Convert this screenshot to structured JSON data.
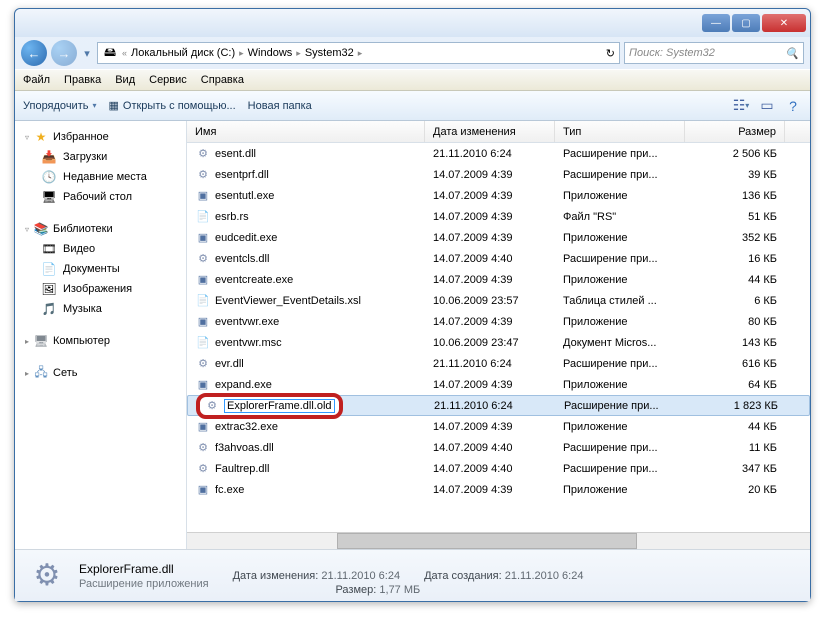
{
  "titlebar": {
    "min": "—",
    "max": "▢",
    "close": "✕"
  },
  "nav": {
    "back": "←",
    "fwd": "→",
    "drop": "▾"
  },
  "address": {
    "icon": "🖴",
    "crumbs": [
      "Локальный диск (C:)",
      "Windows",
      "System32"
    ],
    "sep": "▸",
    "refresh": "↻"
  },
  "search": {
    "placeholder": "Поиск: System32",
    "icon": "🔍"
  },
  "menu": [
    "Файл",
    "Правка",
    "Вид",
    "Сервис",
    "Справка"
  ],
  "toolbar": {
    "organize": "Упорядочить",
    "openwith": "Открыть с помощью...",
    "newfolder": "Новая папка",
    "drop": "▾"
  },
  "sidebar": {
    "favorites": {
      "label": "Избранное",
      "arr": "▿",
      "items": [
        {
          "icon": "📥",
          "label": "Загрузки"
        },
        {
          "icon": "🕓",
          "label": "Недавние места"
        },
        {
          "icon": "🖥",
          "label": "Рабочий стол"
        }
      ]
    },
    "libraries": {
      "label": "Библиотеки",
      "arr": "▿",
      "items": [
        {
          "icon": "🎞",
          "label": "Видео"
        },
        {
          "icon": "📄",
          "label": "Документы"
        },
        {
          "icon": "🖼",
          "label": "Изображения"
        },
        {
          "icon": "🎵",
          "label": "Музыка"
        }
      ]
    },
    "computer": {
      "label": "Компьютер",
      "arr": "▸"
    },
    "network": {
      "label": "Сеть",
      "arr": "▸"
    }
  },
  "columns": {
    "name": "Имя",
    "date": "Дата изменения",
    "type": "Тип",
    "size": "Размер"
  },
  "files": [
    {
      "icon": "dll",
      "name": "esent.dll",
      "date": "21.11.2010 6:24",
      "type": "Расширение при...",
      "size": "2 506 КБ"
    },
    {
      "icon": "dll",
      "name": "esentprf.dll",
      "date": "14.07.2009 4:39",
      "type": "Расширение при...",
      "size": "39 КБ"
    },
    {
      "icon": "exe",
      "name": "esentutl.exe",
      "date": "14.07.2009 4:39",
      "type": "Приложение",
      "size": "136 КБ"
    },
    {
      "icon": "file",
      "name": "esrb.rs",
      "date": "14.07.2009 4:39",
      "type": "Файл \"RS\"",
      "size": "51 КБ"
    },
    {
      "icon": "exe",
      "name": "eudcedit.exe",
      "date": "14.07.2009 4:39",
      "type": "Приложение",
      "size": "352 КБ"
    },
    {
      "icon": "dll",
      "name": "eventcls.dll",
      "date": "14.07.2009 4:40",
      "type": "Расширение при...",
      "size": "16 КБ"
    },
    {
      "icon": "exe",
      "name": "eventcreate.exe",
      "date": "14.07.2009 4:39",
      "type": "Приложение",
      "size": "44 КБ"
    },
    {
      "icon": "file",
      "name": "EventViewer_EventDetails.xsl",
      "date": "10.06.2009 23:57",
      "type": "Таблица стилей ...",
      "size": "6 КБ"
    },
    {
      "icon": "exe",
      "name": "eventvwr.exe",
      "date": "14.07.2009 4:39",
      "type": "Приложение",
      "size": "80 КБ"
    },
    {
      "icon": "file",
      "name": "eventvwr.msc",
      "date": "10.06.2009 23:47",
      "type": "Документ Micros...",
      "size": "143 КБ"
    },
    {
      "icon": "dll",
      "name": "evr.dll",
      "date": "21.11.2010 6:24",
      "type": "Расширение при...",
      "size": "616 КБ"
    },
    {
      "icon": "exe",
      "name": "expand.exe",
      "date": "14.07.2009 4:39",
      "type": "Приложение",
      "size": "64 КБ"
    },
    {
      "icon": "dll",
      "name": "ExplorerFrame.dll.old",
      "date": "21.11.2010 6:24",
      "type": "Расширение при...",
      "size": "1 823 КБ",
      "selected": true,
      "rename": true
    },
    {
      "icon": "exe",
      "name": "extrac32.exe",
      "date": "14.07.2009 4:39",
      "type": "Приложение",
      "size": "44 КБ"
    },
    {
      "icon": "dll",
      "name": "f3ahvoas.dll",
      "date": "14.07.2009 4:40",
      "type": "Расширение при...",
      "size": "11 КБ"
    },
    {
      "icon": "dll",
      "name": "Faultrep.dll",
      "date": "14.07.2009 4:40",
      "type": "Расширение при...",
      "size": "347 КБ"
    },
    {
      "icon": "exe",
      "name": "fc.exe",
      "date": "14.07.2009 4:39",
      "type": "Приложение",
      "size": "20 КБ"
    }
  ],
  "details": {
    "name": "ExplorerFrame.dll",
    "type": "Расширение приложения",
    "date_label": "Дата изменения:",
    "date": "21.11.2010 6:24",
    "created_label": "Дата создания:",
    "created": "21.11.2010 6:24",
    "size_label": "Размер:",
    "size": "1,77 МБ"
  }
}
